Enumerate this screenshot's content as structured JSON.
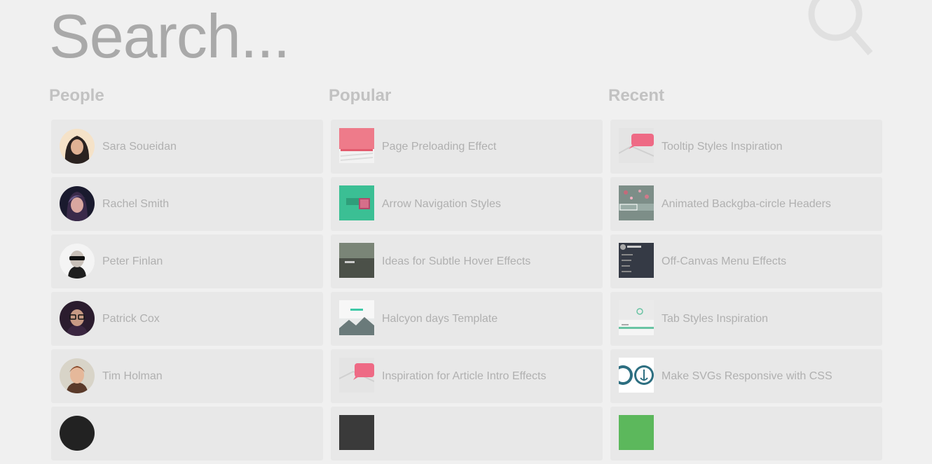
{
  "search": {
    "placeholder": "Search..."
  },
  "columns": {
    "people": {
      "title": "People",
      "items": [
        {
          "label": "Sara Soueidan",
          "icon": "avatar-sara"
        },
        {
          "label": "Rachel Smith",
          "icon": "avatar-rachel"
        },
        {
          "label": "Peter Finlan",
          "icon": "avatar-peter"
        },
        {
          "label": "Patrick Cox",
          "icon": "avatar-patrick"
        },
        {
          "label": "Tim Holman",
          "icon": "avatar-tim"
        },
        {
          "label": "",
          "icon": "avatar-partial"
        }
      ]
    },
    "popular": {
      "title": "Popular",
      "items": [
        {
          "label": "Page Preloading Effect",
          "icon": "thumb-preloading"
        },
        {
          "label": "Arrow Navigation Styles",
          "icon": "thumb-arrow-nav"
        },
        {
          "label": "Ideas for Subtle Hover Effects",
          "icon": "thumb-hover"
        },
        {
          "label": "Halcyon days Template",
          "icon": "thumb-halcyon"
        },
        {
          "label": "Inspiration for Article Intro Effects",
          "icon": "thumb-article-intro"
        },
        {
          "label": "",
          "icon": "thumb-partial"
        }
      ]
    },
    "recent": {
      "title": "Recent",
      "items": [
        {
          "label": "Tooltip Styles Inspiration",
          "icon": "thumb-tooltip"
        },
        {
          "label": "Animated Backgba-circle Headers",
          "icon": "thumb-animated-headers"
        },
        {
          "label": "Off-Canvas Menu Effects",
          "icon": "thumb-off-canvas"
        },
        {
          "label": "Tab Styles Inspiration",
          "icon": "thumb-tab-styles"
        },
        {
          "label": "Make SVGs Responsive with CSS",
          "icon": "thumb-svg-responsive"
        },
        {
          "label": "",
          "icon": "thumb-partial-green"
        }
      ]
    }
  },
  "colors": {
    "background": "#f0f0f0",
    "card": "#e8e8e8",
    "text_muted": "#b0b0b0",
    "heading": "#c2c2c2"
  }
}
